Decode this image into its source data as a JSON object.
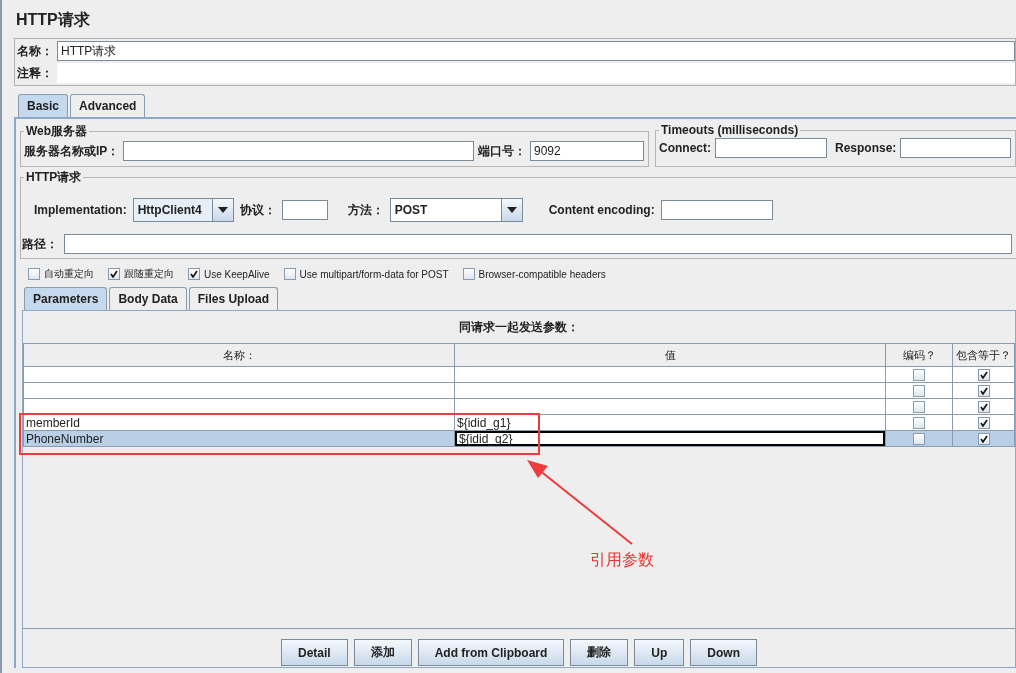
{
  "title": "HTTP请求",
  "name_field": {
    "label": "名称：",
    "value": "HTTP请求"
  },
  "comment_field": {
    "label": "注释："
  },
  "tabs": [
    {
      "label": "Basic",
      "selected": true
    },
    {
      "label": "Advanced",
      "selected": false
    }
  ],
  "web_server": {
    "legend": "Web服务器",
    "server_label": "服务器名称或IP：",
    "port_label": "端口号：",
    "port_value": "9092"
  },
  "timeouts": {
    "legend": "Timeouts (milliseconds)",
    "connect_label": "Connect:",
    "response_label": "Response:"
  },
  "http_request": {
    "legend": "HTTP请求",
    "implementation_label": "Implementation:",
    "implementation": "HttpClient4",
    "protocol_label": "协议：",
    "method_label": "方法：",
    "method": "POST",
    "encoding_label": "Content encoding:",
    "path_label": "路径："
  },
  "options": [
    {
      "label": "自动重定向",
      "checked": false
    },
    {
      "label": "跟随重定向",
      "checked": true
    },
    {
      "label": "Use KeepAlive",
      "checked": true
    },
    {
      "label": "Use multipart/form-data for POST",
      "checked": false
    },
    {
      "label": "Browser-compatible headers",
      "checked": false
    }
  ],
  "sub_tabs": [
    {
      "label": "Parameters",
      "selected": true
    },
    {
      "label": "Body Data",
      "selected": false
    },
    {
      "label": "Files Upload",
      "selected": false
    }
  ],
  "parameters": {
    "caption": "同请求一起发送参数：",
    "columns": [
      "名称：",
      "值",
      "编码？",
      "包含等于？"
    ],
    "rows": [
      {
        "encode": false,
        "include_equals": true,
        "selected": false,
        "editing": false
      },
      {
        "encode": false,
        "include_equals": true,
        "selected": false,
        "editing": false
      },
      {
        "encode": false,
        "include_equals": true,
        "selected": false,
        "editing": false
      },
      {
        "name": "memberId",
        "value": "${idid_g1}",
        "encode": false,
        "include_equals": true,
        "selected": false,
        "editing": false
      },
      {
        "name": "PhoneNumber",
        "value": "${idid_g2}",
        "encode": false,
        "include_equals": true,
        "selected": true,
        "editing": true
      }
    ]
  },
  "annotation": {
    "text": "引用参数"
  },
  "buttons": [
    "Detail",
    "添加",
    "Add from Clipboard",
    "删除",
    "Up",
    "Down"
  ]
}
